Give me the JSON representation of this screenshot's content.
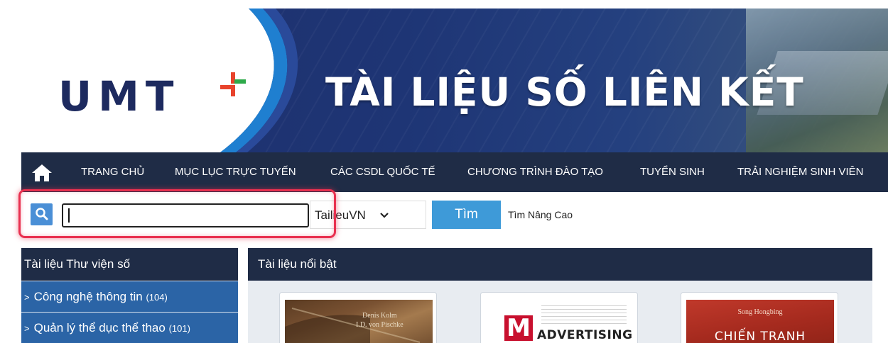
{
  "banner": {
    "logo_text": "UMT",
    "title": "TÀI LIỆU SỐ LIÊN KẾT"
  },
  "nav": {
    "items": [
      {
        "label": "TRANG CHỦ"
      },
      {
        "label": "MỤC LỤC TRỰC TUYẾN"
      },
      {
        "label": "CÁC CSDL QUỐC TẾ"
      },
      {
        "label": "CHƯƠNG TRÌNH ĐÀO TẠO"
      },
      {
        "label": "TUYỂN SINH"
      },
      {
        "label": "TRẢI NGHIỆM SINH VIÊN"
      }
    ]
  },
  "search": {
    "value": "",
    "select_value": "TailieuVN",
    "submit_label": "Tìm",
    "advanced_label": "Tìm Nâng Cao"
  },
  "sidebar": {
    "title": "Tài liệu Thư viện số",
    "items": [
      {
        "label": "Công nghệ thông tin",
        "count": "(104)"
      },
      {
        "label": "Quản lý thể dục thể thao",
        "count": "(101)"
      }
    ]
  },
  "featured": {
    "title": "Tài liệu nổi bật",
    "books": [
      {
        "cover_text_1": "Denis Kolm",
        "cover_text_2": "I.D. von Pischke"
      },
      {
        "cover_letter": "M",
        "cover_word": "ADVERTISING"
      },
      {
        "cover_author": "Song Hongbing",
        "cover_title": "CHIẾN TRANH"
      }
    ]
  },
  "colors": {
    "nav_bg": "#1f2c46",
    "banner_bg": "#1e3575",
    "accent_blue": "#3e9ad8",
    "sidebar_item_bg": "#2b64a6",
    "highlight": "#e8304f"
  }
}
